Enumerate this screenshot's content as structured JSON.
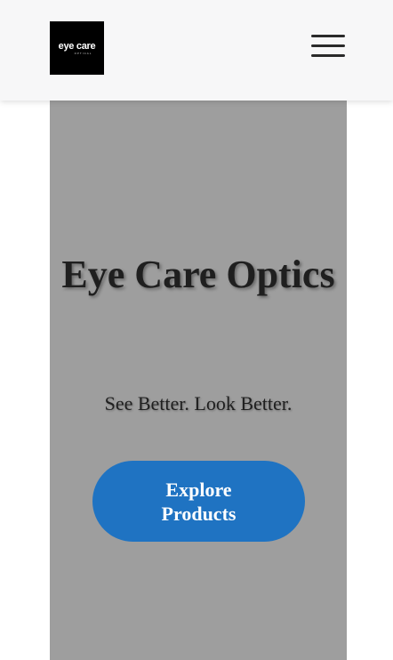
{
  "header": {
    "logo_text": "eye care",
    "logo_subtext": "OPTICAL",
    "menu_icon": "hamburger-menu-icon"
  },
  "hero": {
    "title": "Eye Care Optics",
    "tagline": "See Better. Look Better.",
    "cta_label": "Explore Products"
  },
  "colors": {
    "header_bg": "#f7f7f8",
    "hero_bg": "#9e9e9e",
    "cta_bg": "#1f73c2",
    "cta_text": "#ffffff",
    "title_text": "#1f1f1f"
  }
}
